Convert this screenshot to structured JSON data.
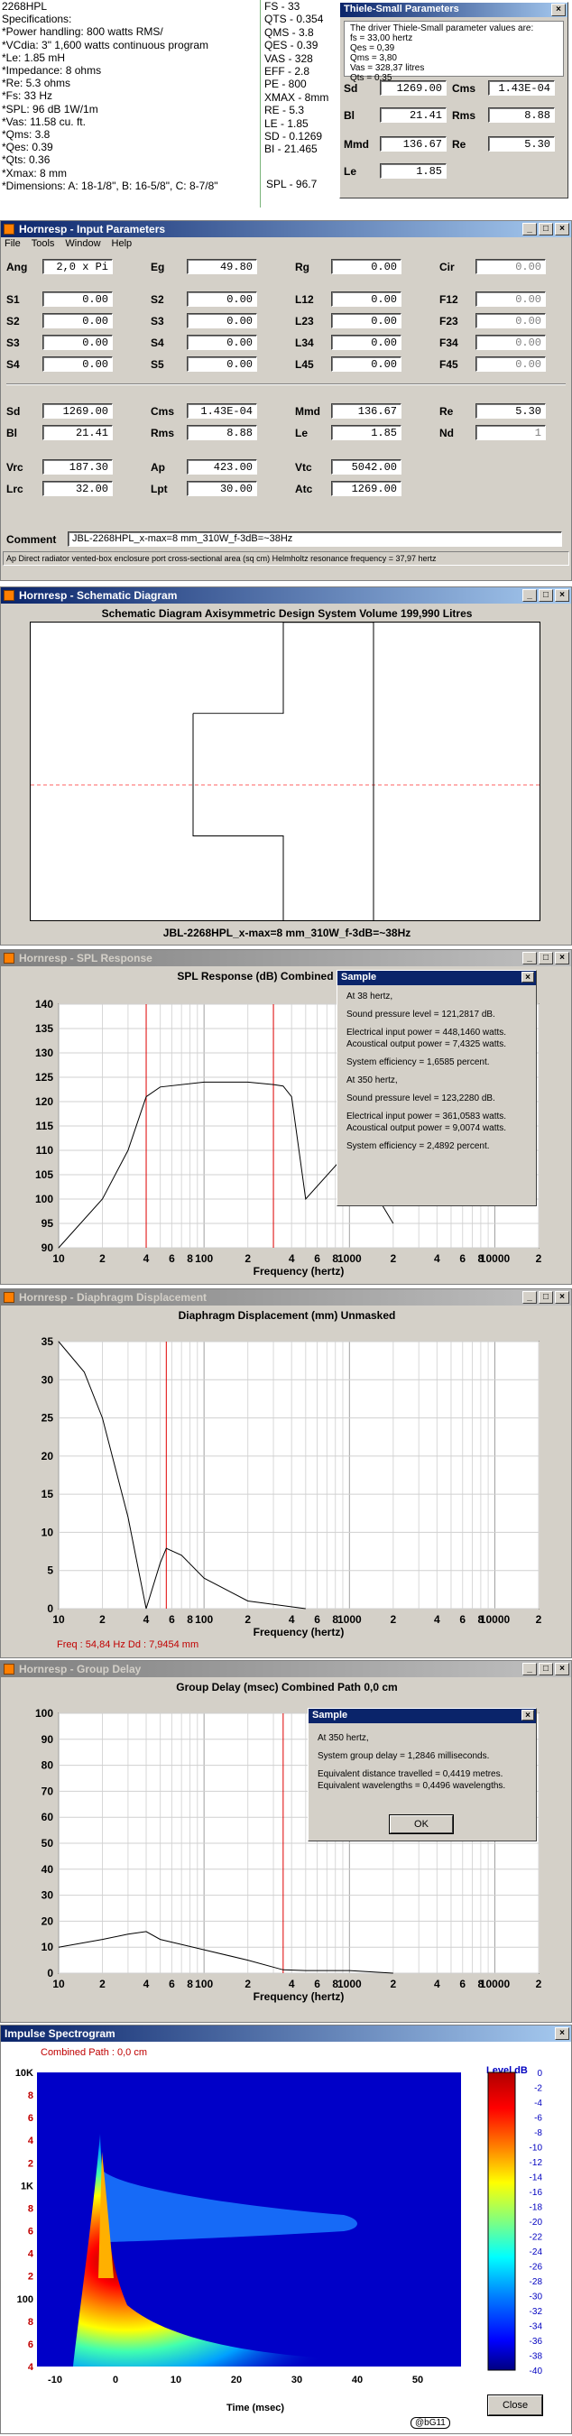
{
  "specs": {
    "lines": [
      "2268HPL",
      "Specifications:",
      "*Power handling: 800 watts RMS/",
      "*VCdia: 3\"       1,600 watts continuous program",
      "*Le: 1.85 mH",
      "*Impedance: 8 ohms",
      "*Re: 5.3 ohms",
      "*Fs: 33 Hz",
      "*SPL: 96 dB 1W/1m",
      "*Vas: 11.58 cu. ft.",
      "*Qms: 3.8",
      "*Qes: 0.39",
      "*Qts: 0.36",
      "*Xmax: 8 mm",
      "*Dimensions: A: 18-1/8\", B: 16-5/8\", C: 8-7/8\""
    ],
    "right_lines": [
      "FS - 33",
      "QTS - 0.354",
      "QMS - 3.8",
      "QES - 0.39",
      "VAS - 328",
      "EFF - 2.8",
      "PE - 800",
      "XMAX - 8mm",
      "RE - 5.3",
      "LE - 1.85",
      "SD - 0.1269",
      "BI - 21.465"
    ],
    "spl_line": "SPL - 96.7"
  },
  "ts_window": {
    "title": "Thiele-Small Parameters",
    "intro": "The driver Thiele-Small parameter values are:",
    "lines": [
      "fs = 33,00 hertz",
      "Qes = 0,39",
      "Qms = 3,80",
      "Vas = 328,37 litres",
      "Qts = 0,35"
    ],
    "fields": [
      {
        "label": "Sd",
        "value": "1269.00"
      },
      {
        "label": "Cms",
        "value": "1.43E-04"
      },
      {
        "label": "Bl",
        "value": "21.41"
      },
      {
        "label": "Rms",
        "value": "8.88"
      },
      {
        "label": "Mmd",
        "value": "136.67"
      },
      {
        "label": "Re",
        "value": "5.30"
      },
      {
        "label": "Le",
        "value": "1.85"
      }
    ]
  },
  "input_params": {
    "title": "Hornresp - Input Parameters",
    "menu": [
      "File",
      "Tools",
      "Window",
      "Help"
    ],
    "rows1": [
      [
        {
          "l": "Ang",
          "v": "2,0 x Pi"
        },
        {
          "l": "Eg",
          "v": "49.80"
        },
        {
          "l": "Rg",
          "v": "0.00"
        },
        {
          "l": "Cir",
          "v": "0.00",
          "dis": true
        }
      ],
      [
        {
          "l": "S1",
          "v": "0.00"
        },
        {
          "l": "S2",
          "v": "0.00"
        },
        {
          "l": "L12",
          "v": "0.00"
        },
        {
          "l": "F12",
          "v": "0.00",
          "dis": true
        }
      ],
      [
        {
          "l": "S2",
          "v": "0.00"
        },
        {
          "l": "S3",
          "v": "0.00"
        },
        {
          "l": "L23",
          "v": "0.00"
        },
        {
          "l": "F23",
          "v": "0.00",
          "dis": true
        }
      ],
      [
        {
          "l": "S3",
          "v": "0.00"
        },
        {
          "l": "S4",
          "v": "0.00"
        },
        {
          "l": "L34",
          "v": "0.00"
        },
        {
          "l": "F34",
          "v": "0.00",
          "dis": true
        }
      ],
      [
        {
          "l": "S4",
          "v": "0.00"
        },
        {
          "l": "S5",
          "v": "0.00"
        },
        {
          "l": "L45",
          "v": "0.00"
        },
        {
          "l": "F45",
          "v": "0.00",
          "dis": true
        }
      ]
    ],
    "rows2": [
      [
        {
          "l": "Sd",
          "v": "1269.00"
        },
        {
          "l": "Cms",
          "v": "1.43E-04"
        },
        {
          "l": "Mmd",
          "v": "136.67"
        },
        {
          "l": "Re",
          "v": "5.30"
        }
      ],
      [
        {
          "l": "Bl",
          "v": "21.41"
        },
        {
          "l": "Rms",
          "v": "8.88"
        },
        {
          "l": "Le",
          "v": "1.85"
        },
        {
          "l": "Nd",
          "v": "1",
          "dis": true
        }
      ]
    ],
    "rows3": [
      [
        {
          "l": "Vrc",
          "v": "187.30"
        },
        {
          "l": "Ap",
          "v": "423.00"
        },
        {
          "l": "Vtc",
          "v": "5042.00"
        }
      ],
      [
        {
          "l": "Lrc",
          "v": "32.00"
        },
        {
          "l": "Lpt",
          "v": "30.00"
        },
        {
          "l": "Atc",
          "v": "1269.00"
        }
      ]
    ],
    "comment_label": "Comment",
    "comment": "JBL-2268HPL_x-max=8 mm_310W_f-3dB=~38Hz",
    "status": "Ap   Direct radiator vented-box enclosure port cross-sectional area  (sq cm)    Helmholtz resonance frequency = 37,97 hertz"
  },
  "schematic": {
    "title": "Hornresp - Schematic Diagram",
    "header": "Schematic Diagram    Axisymmetric Design    System Volume 199,990 Litres",
    "footer": "JBL-2268HPL_x-max=8 mm_310W_f-3dB=~38Hz"
  },
  "spl": {
    "title": "Hornresp - SPL Response",
    "header": "SPL Response (dB)    Combined    Path 0,0 cm",
    "xlabel": "Frequency (hertz)",
    "yticks": [
      "140",
      "135",
      "130",
      "125",
      "120",
      "115",
      "110",
      "105",
      "100",
      "95",
      "90"
    ],
    "xticks": [
      "10",
      "2",
      "4",
      "6",
      "8",
      "100",
      "2",
      "4",
      "6",
      "8",
      "1000",
      "2",
      "4",
      "6",
      "8",
      "10000",
      "2"
    ],
    "dialog": {
      "title": "Sample",
      "lines": [
        "At 38 hertz,",
        "",
        "Sound pressure level = 121,2817 dB.",
        "",
        "Electrical input power = 448,1460 watts.",
        "Acoustical output power = 7,4325 watts.",
        "",
        "System efficiency = 1,6585 percent.",
        "",
        "At 350 hertz,",
        "",
        "Sound pressure level = 123,2280 dB.",
        "",
        "Electrical input power = 361,0583 watts.",
        "Acoustical output power = 9,0074 watts.",
        "",
        "System efficiency = 2,4892 percent."
      ]
    }
  },
  "disp": {
    "title": "Hornresp - Diaphragm Displacement",
    "header": "Diaphragm Displacement (mm)    Unmasked",
    "xlabel": "Frequency (hertz)",
    "yticks": [
      "35",
      "30",
      "25",
      "20",
      "15",
      "10",
      "5",
      "0"
    ],
    "xticks": [
      "10",
      "2",
      "4",
      "6",
      "8",
      "100",
      "2",
      "4",
      "6",
      "8",
      "1000",
      "2",
      "4",
      "6",
      "8",
      "10000",
      "2"
    ],
    "readout": "Freq : 54,84 Hz     Dd : 7,9454 mm"
  },
  "gd": {
    "title": "Hornresp - Group Delay",
    "header": "Group Delay (msec)    Combined    Path 0,0 cm",
    "xlabel": "Frequency (hertz)",
    "yticks": [
      "100",
      "90",
      "80",
      "70",
      "60",
      "50",
      "40",
      "30",
      "20",
      "10",
      "0"
    ],
    "xticks": [
      "10",
      "2",
      "4",
      "6",
      "8",
      "100",
      "2",
      "4",
      "6",
      "8",
      "1000",
      "2",
      "4",
      "6",
      "8",
      "10000",
      "2"
    ],
    "dialog": {
      "title": "Sample",
      "lines": [
        "At 350 hertz,",
        "",
        "System group delay = 1,2846 milliseconds.",
        "",
        "Equivalent distance travelled = 0,4419 metres.",
        "Equivalent wavelengths = 0,4496 wavelengths."
      ],
      "ok": "OK"
    }
  },
  "spectro": {
    "title": "Impulse Spectrogram",
    "header": "Combined    Path : 0,0 cm",
    "level_label": "Level  dB",
    "levels": [
      "0",
      "-2",
      "-4",
      "-6",
      "-8",
      "-10",
      "-12",
      "-14",
      "-16",
      "-18",
      "-20",
      "-22",
      "-24",
      "-26",
      "-28",
      "-30",
      "-32",
      "-34",
      "-36",
      "-38",
      "-40"
    ],
    "yticks": [
      "10K",
      "8",
      "6",
      "4",
      "2",
      "1K",
      "8",
      "6",
      "4",
      "2",
      "100",
      "8",
      "6",
      "4"
    ],
    "xticks": [
      "-10",
      "0",
      "10",
      "20",
      "30",
      "40",
      "50"
    ],
    "xlabel": "Time (msec)",
    "close": "Close",
    "badge": "@bG11"
  },
  "chart_data": [
    {
      "type": "line",
      "title": "SPL Response (dB)",
      "xlabel": "Frequency (hertz)",
      "ylabel": "",
      "ylim": [
        90,
        140
      ],
      "xscale": "log",
      "x": [
        10,
        20,
        30,
        40,
        50,
        100,
        200,
        300,
        350,
        400,
        500,
        1000,
        2000
      ],
      "series": [
        {
          "values": [
            90,
            100,
            110,
            121,
            123,
            124,
            124,
            123.5,
            123.2,
            121,
            100,
            110,
            95
          ]
        }
      ]
    },
    {
      "type": "line",
      "title": "Diaphragm Displacement (mm)",
      "xlabel": "Frequency (hertz)",
      "ylim": [
        0,
        35
      ],
      "xscale": "log",
      "x": [
        10,
        15,
        20,
        30,
        40,
        50,
        55,
        70,
        100,
        200,
        500
      ],
      "series": [
        {
          "values": [
            35,
            31,
            25,
            12,
            0,
            6,
            7.9,
            7,
            4,
            1,
            0
          ]
        }
      ]
    },
    {
      "type": "line",
      "title": "Group Delay (msec)",
      "xlabel": "Frequency (hertz)",
      "ylim": [
        0,
        100
      ],
      "xscale": "log",
      "x": [
        10,
        20,
        30,
        40,
        50,
        100,
        200,
        350,
        500,
        1000,
        2000
      ],
      "series": [
        {
          "values": [
            10,
            13,
            15,
            16,
            13,
            9,
            5,
            1.3,
            1,
            1,
            0
          ]
        }
      ]
    }
  ]
}
